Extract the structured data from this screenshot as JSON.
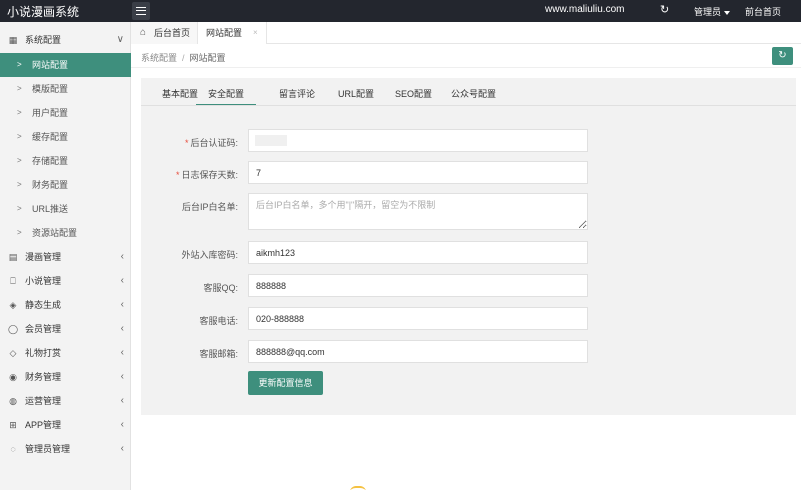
{
  "header": {
    "brand": "小说漫画系统",
    "site_url": "www.maliuliu.com",
    "admin_label": "管理员",
    "front_home": "前台首页",
    "refresh_icon": "↻"
  },
  "sidebar": {
    "groups": [
      {
        "label": "系统配置",
        "icon": "▦",
        "arrow": "∨"
      },
      {
        "label": "漫画管理",
        "icon": "▤",
        "arrow": "‹"
      },
      {
        "label": "小说管理",
        "icon": "⎕",
        "arrow": "‹"
      },
      {
        "label": "静态生成",
        "icon": "◈",
        "arrow": "‹"
      },
      {
        "label": "会员管理",
        "icon": "◯",
        "arrow": "‹"
      },
      {
        "label": "礼物打赏",
        "icon": "◇",
        "arrow": "‹"
      },
      {
        "label": "财务管理",
        "icon": "◉",
        "arrow": "‹"
      },
      {
        "label": "运营管理",
        "icon": "◍",
        "arrow": "‹"
      },
      {
        "label": "APP管理",
        "icon": "⊞",
        "arrow": "‹"
      },
      {
        "label": "管理员管理",
        "icon": "◌",
        "arrow": "‹"
      }
    ],
    "sub_items": [
      {
        "label": "网站配置",
        "chev": ">",
        "active": true
      },
      {
        "label": "模版配置",
        "chev": ">"
      },
      {
        "label": "用户配置",
        "chev": ">"
      },
      {
        "label": "缓存配置",
        "chev": ">"
      },
      {
        "label": "存储配置",
        "chev": ">"
      },
      {
        "label": "财务配置",
        "chev": ">"
      },
      {
        "label": "URL推送",
        "chev": ">"
      },
      {
        "label": "资源站配置",
        "chev": ">"
      }
    ]
  },
  "tabs": {
    "home_label": "后台首页",
    "home_icon": "⌂",
    "current_label": "网站配置",
    "close_icon": "×"
  },
  "breadcrumb": {
    "parent": "系统配置",
    "separator": "/",
    "current": "网站配置",
    "refresh_icon": "↻"
  },
  "config_tabs": [
    "基本配置",
    "安全配置",
    "留言评论",
    "URL配置",
    "SEO配置",
    "公众号配置"
  ],
  "form": {
    "auth_code_label": "后台认证码:",
    "log_days_label": "日志保存天数:",
    "log_days_value": "7",
    "ip_whitelist_label": "后台IP白名单:",
    "ip_whitelist_placeholder": "后台IP白名单，多个用\"|\"隔开，留空为不限制",
    "import_pwd_label": "外站入库密码:",
    "import_pwd_value": "aikmh123",
    "qq_label": "客服QQ:",
    "qq_value": "888888",
    "phone_label": "客服电话:",
    "phone_value": "020-888888",
    "email_label": "客服邮箱:",
    "email_value": "888888@qq.com",
    "required_mark": "*",
    "submit_label": "更新配置信息"
  },
  "colors": {
    "accent": "#3e8f7d",
    "topbar": "#23262e",
    "required": "#e74c3c"
  }
}
